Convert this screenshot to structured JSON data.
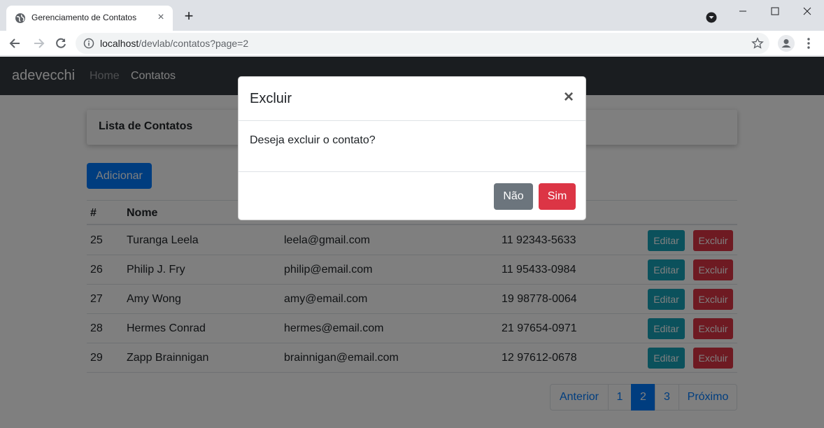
{
  "browser": {
    "tab_title": "Gerenciamento de Contatos",
    "url_host": "localhost",
    "url_path": "/devlab/contatos?page=2"
  },
  "navbar": {
    "brand": "adevecchi",
    "links": [
      "Home",
      "Contatos"
    ]
  },
  "card": {
    "title": "Lista de Contatos"
  },
  "add_button": "Adicionar",
  "table": {
    "headers": {
      "id": "#",
      "nome": "Nome"
    },
    "edit_label": "Editar",
    "delete_label": "Excluir",
    "rows": [
      {
        "id": "25",
        "nome": "Turanga Leela",
        "email": "leela@gmail.com",
        "telefone": "11 92343-5633"
      },
      {
        "id": "26",
        "nome": "Philip J. Fry",
        "email": "philip@email.com",
        "telefone": "11 95433-0984"
      },
      {
        "id": "27",
        "nome": "Amy Wong",
        "email": "amy@email.com",
        "telefone": "19 98778-0064"
      },
      {
        "id": "28",
        "nome": "Hermes Conrad",
        "email": "hermes@email.com",
        "telefone": "21 97654-0971"
      },
      {
        "id": "29",
        "nome": "Zapp Brainnigan",
        "email": "brainnigan@email.com",
        "telefone": "12 97612-0678"
      }
    ]
  },
  "pagination": {
    "prev": "Anterior",
    "pages": [
      "1",
      "2",
      "3"
    ],
    "current": "2",
    "next": "Próximo"
  },
  "modal": {
    "title": "Excluir",
    "close": "×",
    "message": "Deseja excluir o contato?",
    "no_label": "Não",
    "yes_label": "Sim"
  },
  "colors": {
    "primary": "#007bff",
    "danger": "#dc3545",
    "info": "#17a2b8",
    "secondary": "#6c757d",
    "navbar": "#343a40"
  },
  "icons": {
    "tab_favicon": "globe-icon",
    "tab_close": "close-icon",
    "new_tab": "plus-icon",
    "back": "arrow-left-icon",
    "forward": "arrow-right-icon",
    "reload": "reload-icon",
    "site_info": "info-icon",
    "bookmark": "star-icon",
    "profile": "avatar-icon",
    "menu": "kebab-menu-icon"
  }
}
